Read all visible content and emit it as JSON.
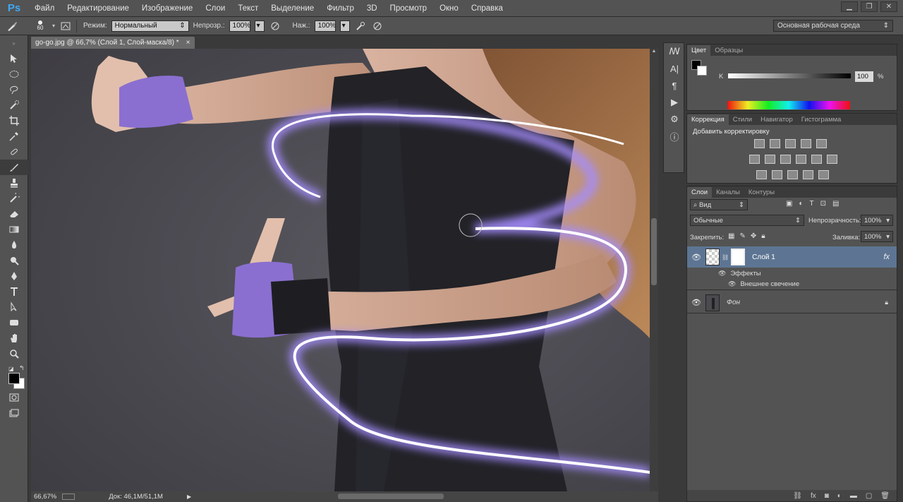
{
  "menubar": {
    "logo": "Ps",
    "items": [
      "Файл",
      "Редактирование",
      "Изображение",
      "Слои",
      "Текст",
      "Выделение",
      "Фильтр",
      "3D",
      "Просмотр",
      "Окно",
      "Справка"
    ]
  },
  "options": {
    "brush_size": "60",
    "mode_label": "Режим:",
    "mode_value": "Нормальный",
    "opacity_label": "Непрозр.:",
    "opacity_value": "100%",
    "pressure_label": "Наж.:",
    "pressure_value": "100%",
    "workspace": "Основная рабочая среда"
  },
  "document": {
    "tab_title": "go-go.jpg @ 66,7% (Слой 1, Слой-маска/8) *",
    "zoom": "66,67%",
    "doc_size": "Док: 46,1M/51,1M"
  },
  "color_panel": {
    "tabs": [
      "Цвет",
      "Образцы"
    ],
    "channel_label": "K",
    "channel_value": "100",
    "unit": "%"
  },
  "adjust_panel": {
    "tabs": [
      "Коррекция",
      "Стили",
      "Навигатор",
      "Гистограмма"
    ],
    "title": "Добавить корректировку"
  },
  "layers_panel": {
    "tabs": [
      "Слои",
      "Каналы",
      "Контуры"
    ],
    "filter_label": "Вид",
    "blend_mode": "Обычные",
    "opacity_label": "Непрозрачность:",
    "opacity_value": "100%",
    "lock_label": "Закрепить:",
    "fill_label": "Заливка:",
    "fill_value": "100%",
    "layers": [
      {
        "name": "Слой 1",
        "effects_label": "Эффекты",
        "effect": "Внешнее свечение",
        "fx": "fx"
      },
      {
        "name": "Фон"
      }
    ]
  },
  "colors": {
    "accent": "#3fa9f5",
    "selected_layer": "#5d7593",
    "glow": "#b7a6ff"
  }
}
